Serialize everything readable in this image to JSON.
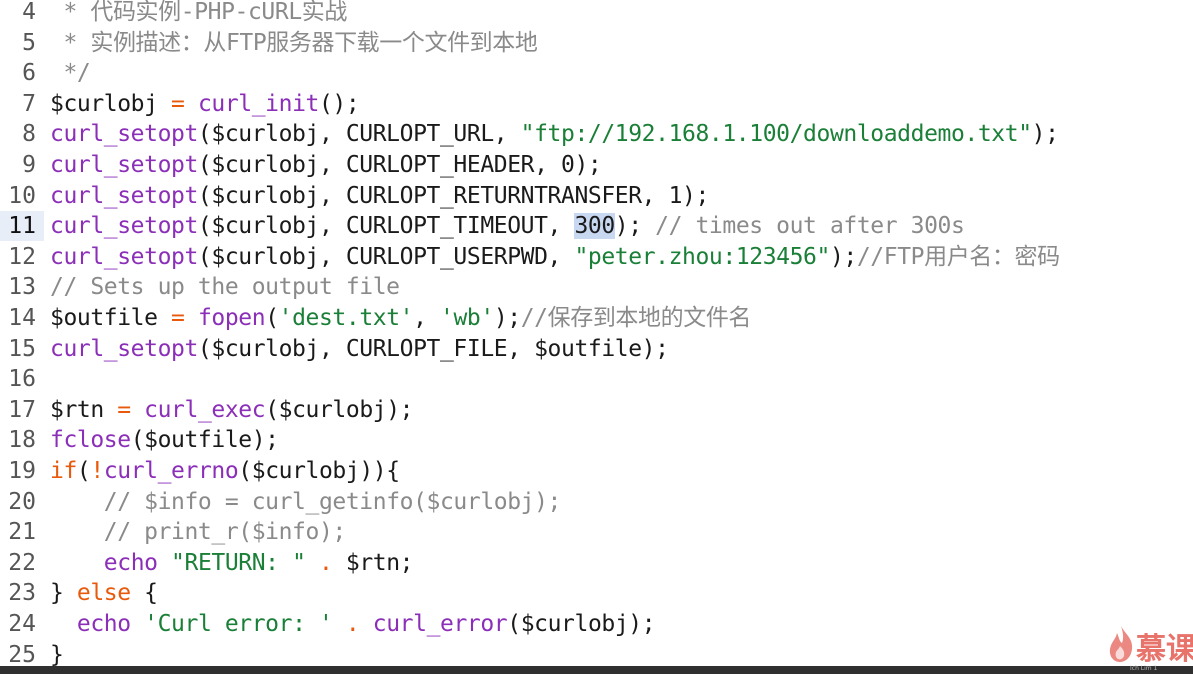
{
  "editor": {
    "lines": [
      {
        "num": "4",
        "tokens": [
          [
            "cmt",
            " * 代码实例-PHP-cURL实战"
          ]
        ]
      },
      {
        "num": "5",
        "tokens": [
          [
            "cmt",
            " * 实例描述：从FTP服务器下载一个文件到本地"
          ]
        ]
      },
      {
        "num": "6",
        "tokens": [
          [
            "cmt",
            " */"
          ]
        ]
      },
      {
        "num": "7",
        "tokens": [
          [
            "var",
            "$curlobj "
          ],
          [
            "op",
            "="
          ],
          [
            "var",
            " "
          ],
          [
            "fn",
            "curl_init"
          ],
          [
            "var",
            "();"
          ]
        ]
      },
      {
        "num": "8",
        "tokens": [
          [
            "fn",
            "curl_setopt"
          ],
          [
            "var",
            "($curlobj, CURLOPT_URL, "
          ],
          [
            "str",
            "\"ftp://192.168.1.100/downloaddemo.txt\""
          ],
          [
            "var",
            ");"
          ]
        ]
      },
      {
        "num": "9",
        "tokens": [
          [
            "fn",
            "curl_setopt"
          ],
          [
            "var",
            "($curlobj, CURLOPT_HEADER, 0);"
          ]
        ]
      },
      {
        "num": "10",
        "tokens": [
          [
            "fn",
            "curl_setopt"
          ],
          [
            "var",
            "($curlobj, CURLOPT_RETURNTRANSFER, 1);"
          ]
        ]
      },
      {
        "num": "11",
        "active": true,
        "tokens": [
          [
            "fn",
            "curl_setopt"
          ],
          [
            "var",
            "($curlobj, CURLOPT_TIMEOUT, "
          ],
          [
            "sel",
            "300"
          ],
          [
            "var",
            "); "
          ],
          [
            "cmt",
            "// times out after 300s"
          ]
        ]
      },
      {
        "num": "12",
        "tokens": [
          [
            "fn",
            "curl_setopt"
          ],
          [
            "var",
            "($curlobj, CURLOPT_USERPWD, "
          ],
          [
            "str",
            "\"peter.zhou:123456\""
          ],
          [
            "var",
            ");"
          ],
          [
            "cmt",
            "//FTP用户名：密码"
          ]
        ]
      },
      {
        "num": "13",
        "tokens": [
          [
            "cmt",
            "// Sets up the output file"
          ]
        ]
      },
      {
        "num": "14",
        "tokens": [
          [
            "var",
            "$outfile "
          ],
          [
            "op",
            "="
          ],
          [
            "var",
            " "
          ],
          [
            "fn",
            "fopen"
          ],
          [
            "var",
            "("
          ],
          [
            "str",
            "'dest.txt'"
          ],
          [
            "var",
            ", "
          ],
          [
            "str",
            "'wb'"
          ],
          [
            "var",
            ");"
          ],
          [
            "cmt",
            "//保存到本地的文件名"
          ]
        ]
      },
      {
        "num": "15",
        "tokens": [
          [
            "fn",
            "curl_setopt"
          ],
          [
            "var",
            "($curlobj, CURLOPT_FILE, $outfile);"
          ]
        ]
      },
      {
        "num": "16",
        "tokens": []
      },
      {
        "num": "17",
        "tokens": [
          [
            "var",
            "$rtn "
          ],
          [
            "op",
            "="
          ],
          [
            "var",
            " "
          ],
          [
            "fn",
            "curl_exec"
          ],
          [
            "var",
            "($curlobj);"
          ]
        ]
      },
      {
        "num": "18",
        "tokens": [
          [
            "fn",
            "fclose"
          ],
          [
            "var",
            "($outfile);"
          ]
        ]
      },
      {
        "num": "19",
        "tokens": [
          [
            "kw",
            "if"
          ],
          [
            "var",
            "("
          ],
          [
            "op",
            "!"
          ],
          [
            "fn",
            "curl_errno"
          ],
          [
            "var",
            "($curlobj)){"
          ]
        ]
      },
      {
        "num": "20",
        "tokens": [
          [
            "var",
            "    "
          ],
          [
            "cmt",
            "// $info = curl_getinfo($curlobj);"
          ]
        ]
      },
      {
        "num": "21",
        "tokens": [
          [
            "var",
            "    "
          ],
          [
            "cmt",
            "// print_r($info);"
          ]
        ]
      },
      {
        "num": "22",
        "tokens": [
          [
            "var",
            "    "
          ],
          [
            "fn",
            "echo"
          ],
          [
            "var",
            " "
          ],
          [
            "str",
            "\"RETURN: \""
          ],
          [
            "var",
            " "
          ],
          [
            "op",
            "."
          ],
          [
            "var",
            " $rtn;"
          ]
        ]
      },
      {
        "num": "23",
        "tokens": [
          [
            "var",
            "} "
          ],
          [
            "kw",
            "else"
          ],
          [
            "var",
            " {"
          ]
        ]
      },
      {
        "num": "24",
        "tokens": [
          [
            "var",
            "  "
          ],
          [
            "fn",
            "echo"
          ],
          [
            "var",
            " "
          ],
          [
            "str",
            "'Curl error: '"
          ],
          [
            "var",
            " "
          ],
          [
            "op",
            "."
          ],
          [
            "var",
            " "
          ],
          [
            "fn",
            "curl_error"
          ],
          [
            "var",
            "($curlobj);"
          ]
        ]
      },
      {
        "num": "25",
        "tokens": [
          [
            "var",
            "}"
          ]
        ]
      }
    ]
  },
  "status": {
    "text": "Ich Lim 1"
  },
  "watermark": {
    "text": "慕课",
    "color": "#e8736b",
    "icon": "flame-logo-icon"
  },
  "colors": {
    "comment": "#8a8a8a",
    "function": "#8b2fb8",
    "keyword": "#e8590c",
    "string": "#1a7f37",
    "selection": "#c8d8f0"
  }
}
